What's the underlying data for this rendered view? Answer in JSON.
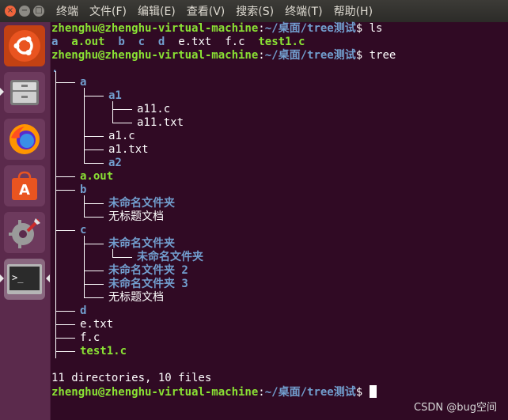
{
  "menubar": {
    "close_glyph": "×",
    "min_glyph": "−",
    "max_glyph": "□",
    "items": [
      "终端",
      "文件(F)",
      "编辑(E)",
      "查看(V)",
      "搜索(S)",
      "终端(T)",
      "帮助(H)"
    ]
  },
  "launcher": {
    "items": [
      {
        "name": "ubuntu-icon",
        "color": "#e95420"
      },
      {
        "name": "files-icon",
        "color": "#7a7a7a"
      },
      {
        "name": "firefox-icon",
        "color": "#ff7139"
      },
      {
        "name": "software-center-icon",
        "color": "#e95420"
      },
      {
        "name": "settings-icon",
        "color": "#888888"
      },
      {
        "name": "terminal-icon",
        "color": "#2e2e2e"
      }
    ]
  },
  "terminal": {
    "prompt_user": "zhenghu@zhenghu-virtual-machine",
    "prompt_colon": ":",
    "prompt_path": "~/桌面/tree测试",
    "prompt_dollar": "$ ",
    "cmd1": "ls",
    "ls_output": [
      {
        "text": "a",
        "type": "dir"
      },
      {
        "text": "a.out",
        "type": "exe"
      },
      {
        "text": "b",
        "type": "dir"
      },
      {
        "text": "c",
        "type": "dir"
      },
      {
        "text": "d",
        "type": "dir"
      },
      {
        "text": "e.txt",
        "type": "txt"
      },
      {
        "text": "f.c",
        "type": "txt"
      },
      {
        "text": "test1.c",
        "type": "exe"
      }
    ],
    "cmd2": "tree",
    "tree_root": ".",
    "tree": [
      {
        "name": "a",
        "type": "dir"
      },
      {
        "name": "a1",
        "type": "dir"
      },
      {
        "name": "a11.c",
        "type": "txt"
      },
      {
        "name": "a11.txt",
        "type": "txt"
      },
      {
        "name": "a1.c",
        "type": "txt"
      },
      {
        "name": "a1.txt",
        "type": "txt"
      },
      {
        "name": "a2",
        "type": "dir"
      },
      {
        "name": "a.out",
        "type": "exe"
      },
      {
        "name": "b",
        "type": "dir"
      },
      {
        "name": "未命名文件夹",
        "type": "dir"
      },
      {
        "name": "无标题文档",
        "type": "txt"
      },
      {
        "name": "c",
        "type": "dir"
      },
      {
        "name": "未命名文件夹",
        "type": "dir"
      },
      {
        "name": "未命名文件夹",
        "type": "dir"
      },
      {
        "name": "未命名文件夹 2",
        "type": "dir"
      },
      {
        "name": "未命名文件夹 3",
        "type": "dir"
      },
      {
        "name": "无标题文档",
        "type": "txt"
      },
      {
        "name": "d",
        "type": "dir"
      },
      {
        "name": "e.txt",
        "type": "txt"
      },
      {
        "name": "f.c",
        "type": "txt"
      },
      {
        "name": "test1.c",
        "type": "exe"
      }
    ],
    "summary": "11 directories, 10 files"
  },
  "watermark": "CSDN @bug空间",
  "colors": {
    "background": "#300a24",
    "prompt_user": "#8ae234",
    "directory": "#729fcf",
    "executable": "#8ae234"
  }
}
